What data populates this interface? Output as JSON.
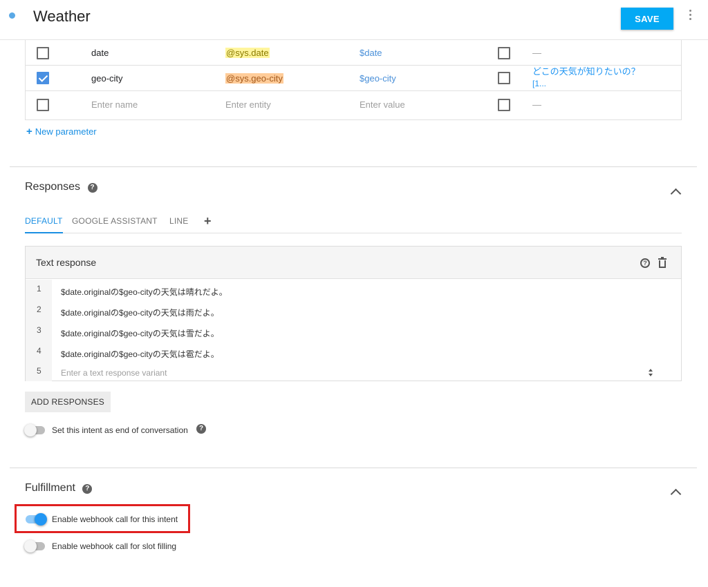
{
  "header": {
    "title": "Weather",
    "save_label": "SAVE"
  },
  "parameters": {
    "rows": [
      {
        "checked": false,
        "name": "date",
        "entity": "@sys.date",
        "value": "$date",
        "list_checked": false,
        "prompt": "—"
      },
      {
        "checked": true,
        "name": "geo-city",
        "entity": "@sys.geo-city",
        "value": "$geo-city",
        "list_checked": false,
        "prompt_line1": "どこの天気が知りたいの？",
        "prompt_line2": "[1..."
      },
      {
        "checked": false,
        "name_placeholder": "Enter name",
        "entity_placeholder": "Enter entity",
        "value_placeholder": "Enter value",
        "list_checked": false,
        "prompt": "—"
      }
    ],
    "new_parameter_label": "New parameter"
  },
  "responses": {
    "title": "Responses",
    "tabs": [
      "DEFAULT",
      "GOOGLE ASSISTANT",
      "LINE"
    ],
    "active_tab": "DEFAULT",
    "add_tab_label": "+",
    "card_title": "Text response",
    "lines": [
      {
        "num": "1",
        "text": "$date.originalの$geo-cityの天気は晴れだよ。"
      },
      {
        "num": "2",
        "text": "$date.originalの$geo-cityの天気は雨だよ。"
      },
      {
        "num": "3",
        "text": "$date.originalの$geo-cityの天気は雪だよ。"
      },
      {
        "num": "4",
        "text": "$date.originalの$geo-cityの天気は雹だよ。"
      },
      {
        "num": "5",
        "placeholder": "Enter a text response variant"
      }
    ],
    "add_responses_label": "ADD RESPONSES",
    "end_conversation_label": "Set this intent as end of conversation",
    "end_conversation_on": false
  },
  "fulfillment": {
    "title": "Fulfillment",
    "webhook_label": "Enable webhook call for this intent",
    "webhook_on": true,
    "slot_filling_label": "Enable webhook call for slot filling",
    "slot_filling_on": false
  },
  "colors": {
    "accent": "#03a9f4",
    "link": "#1a8fe3",
    "highlight_border": "#e02020",
    "entity_date_bg": "#fff59d",
    "entity_city_bg": "#ffcc99"
  }
}
